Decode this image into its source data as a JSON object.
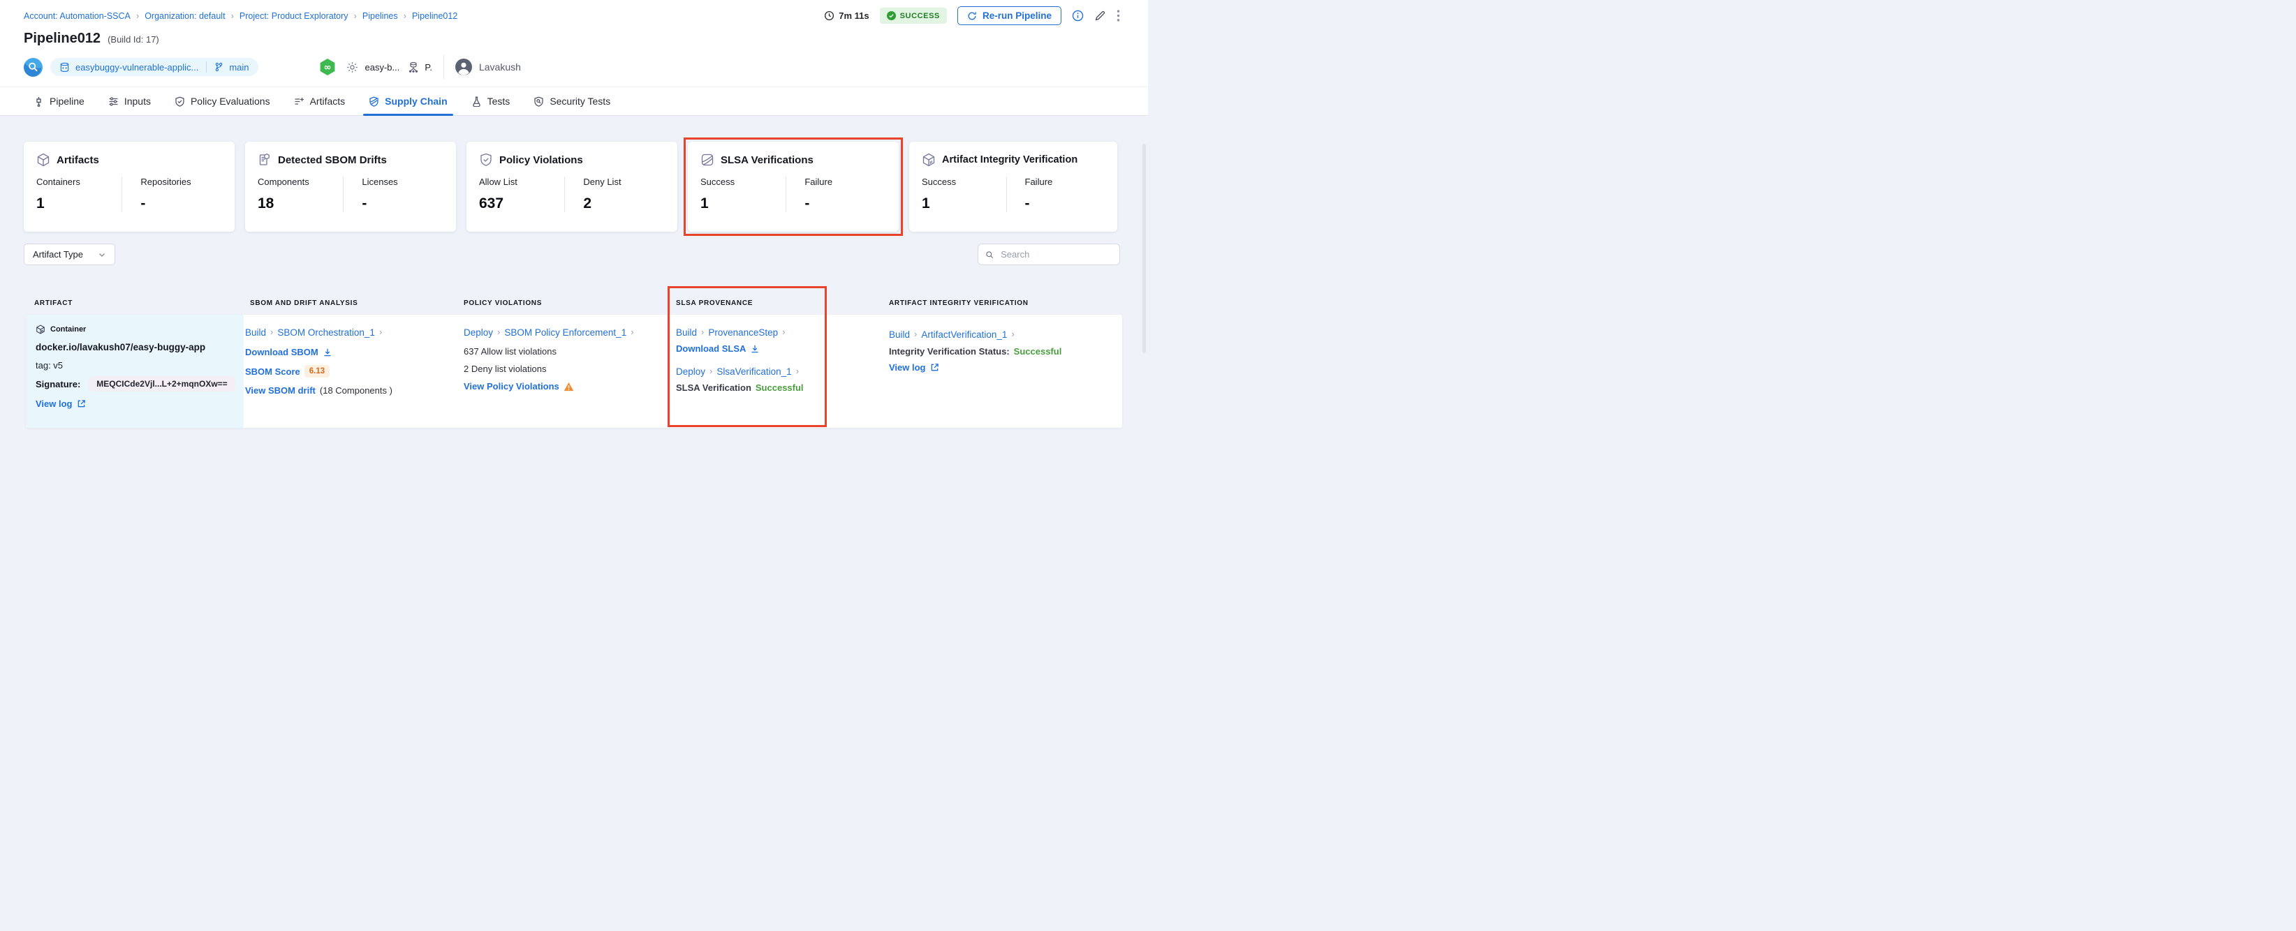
{
  "colors": {
    "primary_blue": "#2170d8",
    "highlight_red": "#e8432c",
    "success_green": "#4a9d3d",
    "status_badge_bg": "#e2f5e3",
    "status_badge_text": "#1f7d23",
    "score_badge_bg": "#fcf0e0",
    "score_badge_text": "#d4691f",
    "warning_orange": "#ef8e33"
  },
  "breadcrumb": {
    "items": [
      "Account: Automation-SSCA",
      "Organization: default",
      "Project: Product Exploratory",
      "Pipelines",
      "Pipeline012"
    ]
  },
  "header": {
    "title": "Pipeline012",
    "build_id": "(Build Id: 17)",
    "duration": "7m 11s",
    "status": "SUCCESS",
    "rerun_label": "Re-run Pipeline",
    "repo_name": "easybuggy-vulnerable-applic...",
    "branch": "main",
    "trigger_text": "easy-b...",
    "trigger_abbrev": "P.",
    "user_name": "Lavakush"
  },
  "tabs": [
    {
      "label": "Pipeline"
    },
    {
      "label": "Inputs"
    },
    {
      "label": "Policy Evaluations"
    },
    {
      "label": "Artifacts"
    },
    {
      "label": "Supply Chain"
    },
    {
      "label": "Tests"
    },
    {
      "label": "Security Tests"
    }
  ],
  "summary_cards": [
    {
      "title": "Artifacts",
      "stats": [
        {
          "label": "Containers",
          "value": "1"
        },
        {
          "label": "Repositories",
          "value": "-"
        }
      ]
    },
    {
      "title": "Detected SBOM Drifts",
      "stats": [
        {
          "label": "Components",
          "value": "18"
        },
        {
          "label": "Licenses",
          "value": "-"
        }
      ]
    },
    {
      "title": "Policy Violations",
      "stats": [
        {
          "label": "Allow List",
          "value": "637"
        },
        {
          "label": "Deny List",
          "value": "2"
        }
      ]
    },
    {
      "title": "SLSA Verifications",
      "highlighted": true,
      "stats": [
        {
          "label": "Success",
          "value": "1"
        },
        {
          "label": "Failure",
          "value": "-"
        }
      ]
    },
    {
      "title": "Artifact Integrity Verification",
      "stats": [
        {
          "label": "Success",
          "value": "1"
        },
        {
          "label": "Failure",
          "value": "-"
        }
      ]
    }
  ],
  "filters": {
    "artifact_type_label": "Artifact Type",
    "search_placeholder": "Search"
  },
  "table": {
    "columns": [
      "ARTIFACT",
      "SBOM AND DRIFT ANALYSIS",
      "POLICY VIOLATIONS",
      "SLSA PROVENANCE",
      "ARTIFACT INTEGRITY VERIFICATION"
    ],
    "row": {
      "artifact": {
        "type_label": "Container",
        "image": "docker.io/lavakush07/easy-buggy-app",
        "tag": "tag: v5",
        "signature_label": "Signature:",
        "signature_value": "MEQCICde2Vjl...L+2+mqnOXw==",
        "view_log": "View log"
      },
      "sbom": {
        "stage": "Build",
        "step": "SBOM Orchestration_1",
        "download": "Download SBOM",
        "score_label": "SBOM Score",
        "score": "6.13",
        "drift_link": "View SBOM drift",
        "drift_note": "(18 Components )"
      },
      "policy": {
        "stage": "Deploy",
        "step": "SBOM Policy Enforcement_1",
        "allow": "637 Allow list violations",
        "deny": "2 Deny list violations",
        "view": "View Policy Violations"
      },
      "slsa": {
        "stage1": "Build",
        "step1": "ProvenanceStep",
        "download": "Download SLSA",
        "stage2": "Deploy",
        "step2": "SlsaVerification_1",
        "status_label": "SLSA Verification",
        "status": "Successful"
      },
      "integrity": {
        "stage": "Build",
        "step": "ArtifactVerification_1",
        "status_label": "Integrity Verification Status:",
        "status": "Successful",
        "view_log": "View log"
      }
    }
  }
}
